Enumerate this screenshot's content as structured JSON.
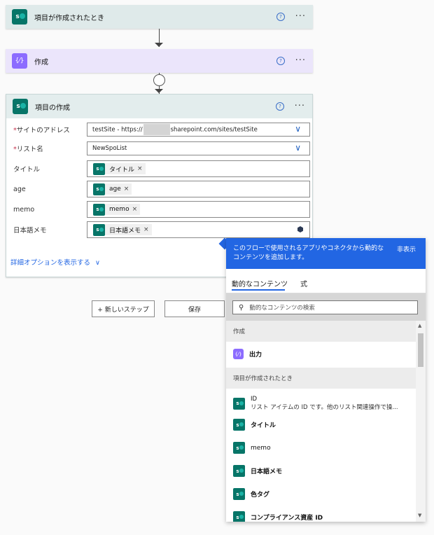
{
  "trigger_card": {
    "title": "項目が作成されたとき",
    "help": "?",
    "more": "···"
  },
  "compose_card": {
    "title": "作成",
    "icon_text": "{⁄}",
    "help": "?",
    "more": "···"
  },
  "create_card": {
    "title": "項目の作成",
    "help": "?",
    "more": "···",
    "site_address": {
      "label": "サイトのアドレス",
      "required_mark": "*",
      "value": "testSite - https://",
      "value_tail": "sharepoint.com/sites/testSite"
    },
    "list_name": {
      "label": "リスト名",
      "required_mark": "*",
      "value": "NewSpoList"
    },
    "fields": [
      {
        "label": "タイトル",
        "token": "タイトル",
        "remove": "×"
      },
      {
        "label": "age",
        "token": "age",
        "remove": "×"
      },
      {
        "label": "memo",
        "token": "memo",
        "remove": "×"
      },
      {
        "label": "日本語メモ",
        "token": "日本語メモ",
        "remove": "×"
      }
    ],
    "advanced_link": "詳細オプションを表示する",
    "advanced_chevron": "∨"
  },
  "buttons": {
    "new_step": "+ 新しいステップ",
    "save": "保存"
  },
  "dynamic_panel": {
    "banner_text": "このフローで使用されるアプリやコネクタから動的な コンテンツを追加します。",
    "hide_label": "非表示",
    "tabs": [
      "動的なコンテンツ",
      "式"
    ],
    "search_placeholder": "動的なコンテンツの検索",
    "sections": [
      {
        "header": "作成",
        "items": [
          {
            "name": "出力",
            "icon": "compose-icon"
          }
        ]
      },
      {
        "header": "項目が作成されたとき",
        "items": [
          {
            "name": "ID",
            "description": "リスト アイテムの ID です。他のリスト関連操作で操...",
            "icon": "sharepoint-icon"
          },
          {
            "name": "タイトル",
            "icon": "sharepoint-icon"
          },
          {
            "name": "memo",
            "icon": "sharepoint-icon"
          },
          {
            "name": "日本語メモ",
            "icon": "sharepoint-icon"
          },
          {
            "name": "色タグ",
            "icon": "sharepoint-icon"
          },
          {
            "name": "コンプライアンス資産 ID",
            "icon": "sharepoint-icon"
          }
        ]
      }
    ]
  },
  "colors": {
    "trigger_header": "#dfeaea",
    "compose_header": "#ebe5fb",
    "create_header": "#e3eded",
    "accent": "#2266e3",
    "sharepoint": "#077568",
    "compose": "#8c6cff"
  }
}
